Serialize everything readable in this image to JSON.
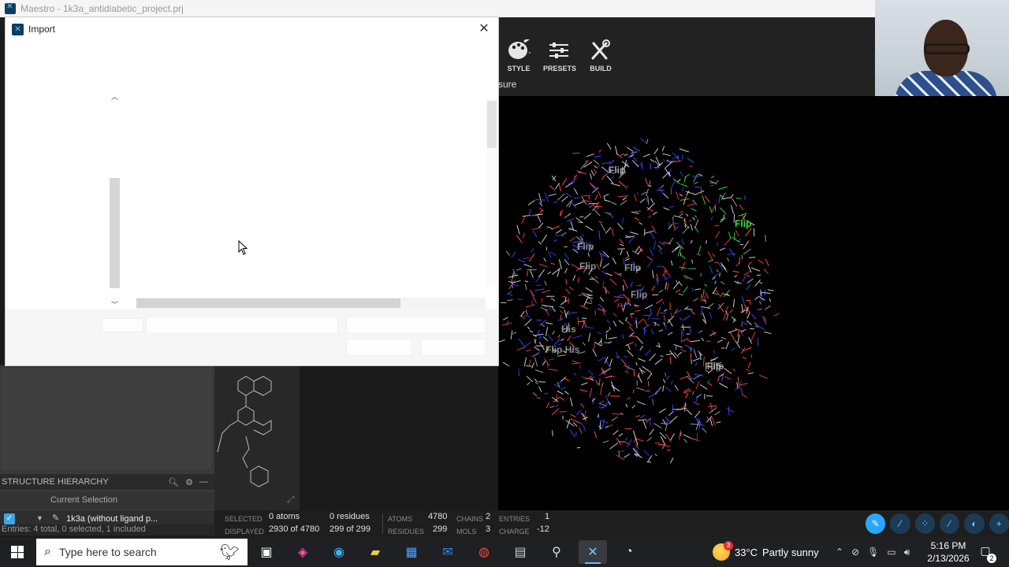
{
  "app_title": "Maestro - 1k3a_antidiabetic_project.prj",
  "toolbar": {
    "style_label": "STYLE",
    "presets_label": "PRESETS",
    "build_label": "BUILD",
    "partial_label": "sure"
  },
  "viewer": {
    "labels": [
      {
        "text": "Flip",
        "color": "#d8d8d8"
      },
      {
        "text": "Flip",
        "color": "#3be03b"
      },
      {
        "text": "Flip",
        "color": "#bdbdbd"
      },
      {
        "text": "Flip",
        "color": "#bdbdbd"
      },
      {
        "text": "Flip",
        "color": "#bdbdbd"
      },
      {
        "text": "Flip",
        "color": "#bdbdbd"
      },
      {
        "text": "His",
        "color": "#bdbdbd"
      },
      {
        "text": "Flip His",
        "color": "#bdbdbd"
      },
      {
        "text": "Flip",
        "color": "#bdbdbd"
      },
      {
        "text": "Flip",
        "color": "#bdbdbd"
      }
    ]
  },
  "dialog": {
    "title": "Import",
    "close_icon": "close-icon"
  },
  "hierarchy": {
    "title": "STRUCTURE HIERARCHY",
    "current_selection": "Current Selection",
    "entry_label": "1k3a (without ligand p...",
    "entries_summary": "Entries: 4 total, 0 selected, 1 included"
  },
  "status": {
    "selected_label": "SELECTED",
    "selected_atoms": "0 atoms",
    "selected_residues": "0 residues",
    "displayed_label": "DISPLAYED",
    "displayed_atoms": "2930 of 4780",
    "displayed_residues": "299 of 299",
    "atoms_label": "ATOMS",
    "atoms_val": "4780",
    "residues_label": "RESIDUES",
    "residues_val": "299",
    "chains_label": "CHAINS",
    "chains_val": "2",
    "mols_label": "MOLS",
    "mols_val": "3",
    "entries_label": "ENTRIES",
    "entries_val": "1",
    "charge_label": "CHARGE",
    "charge_val": "-12"
  },
  "taskbar": {
    "search_placeholder": "Type here to search",
    "weather_temp": "33°C",
    "weather_text": "Partly sunny",
    "weather_badge": "3",
    "time": "5:16 PM",
    "date": "2/13/2026",
    "notifications": "2"
  },
  "colors": {
    "accent": "#29a7ff",
    "dialog_bg": "#ffffff",
    "viewer_bg": "#000000"
  }
}
